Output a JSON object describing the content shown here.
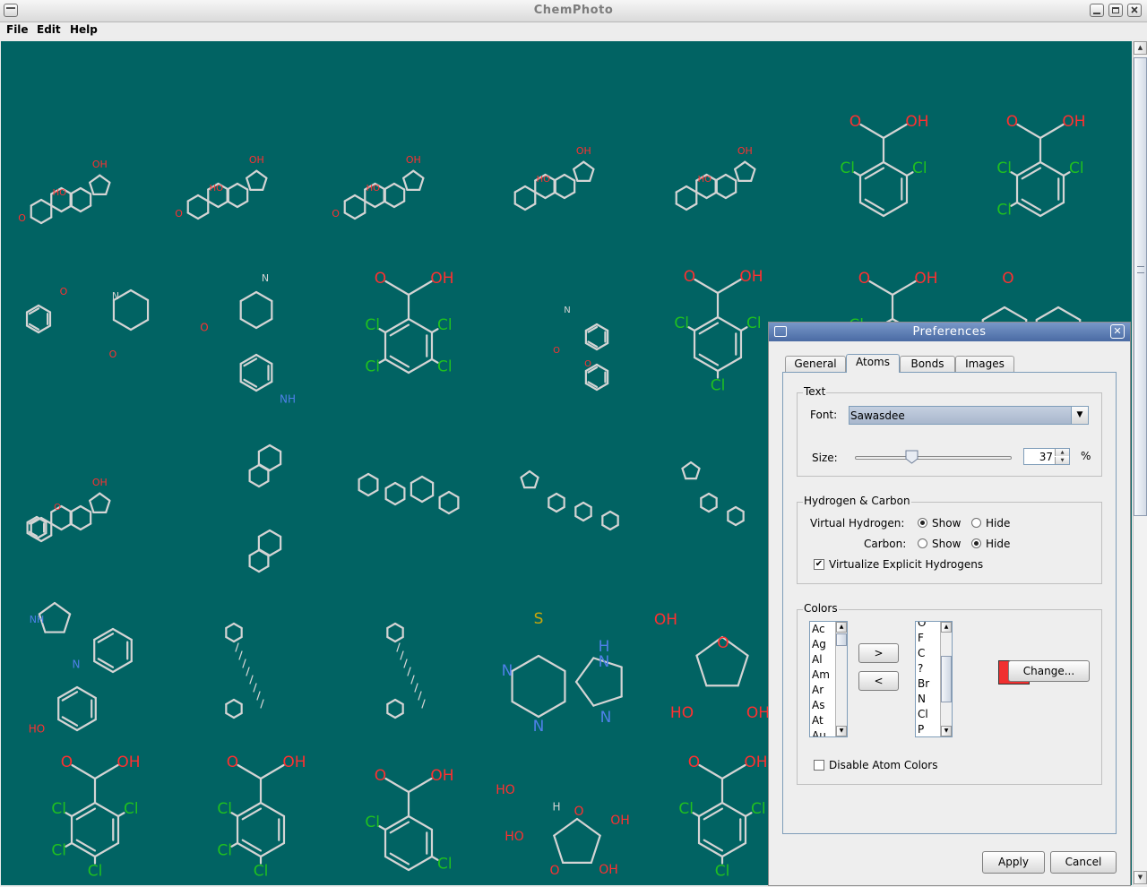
{
  "window": {
    "title": "ChemPhoto"
  },
  "menu": [
    "File",
    "Edit",
    "Help"
  ],
  "colors": {
    "canvas": "#016363",
    "bond": "#d4d4d4",
    "oxygen": "#ff3030",
    "chlorine": "#20c020",
    "nitrogen": "#4e80e8",
    "sulfur": "#c9a60a",
    "atom_swatch": "#f03030",
    "dialog_title": "#4a6ba4"
  },
  "atom_labels": {
    "O": "O",
    "OH": "OH",
    "HO": "HO",
    "Cl": "Cl",
    "N": "N",
    "NH": "NH",
    "H": "H",
    "S": "S"
  },
  "dialog": {
    "title": "Preferences",
    "tabs": [
      "General",
      "Atoms",
      "Bonds",
      "Images"
    ],
    "active_tab": "Atoms",
    "text_group": {
      "label": "Text",
      "font_label": "Font:",
      "font_value": "Sawasdee",
      "size_label": "Size:",
      "size_value": "37",
      "size_unit": "%",
      "size_percent": 37
    },
    "hc_group": {
      "label": "Hydrogen & Carbon",
      "vh_label": "Virtual Hydrogen:",
      "carbon_label": "Carbon:",
      "show": "Show",
      "hide": "Hide",
      "vh_selected": "Show",
      "carbon_selected": "Hide",
      "virtualize_label": "Virtualize Explicit Hydrogens",
      "virtualize_checked": true,
      "check_mark": "✔"
    },
    "colors_group": {
      "label": "Colors",
      "left_list": [
        "Ac",
        "Ag",
        "Al",
        "Am",
        "Ar",
        "As",
        "At",
        "Au"
      ],
      "right_list": [
        "O",
        "F",
        "C",
        "?",
        "Br",
        "N",
        "Cl",
        "P"
      ],
      "add_label": ">",
      "remove_label": "<",
      "change_label": "Change...",
      "disable_label": "Disable Atom Colors",
      "disable_checked": false
    },
    "apply_label": "Apply",
    "cancel_label": "Cancel"
  }
}
